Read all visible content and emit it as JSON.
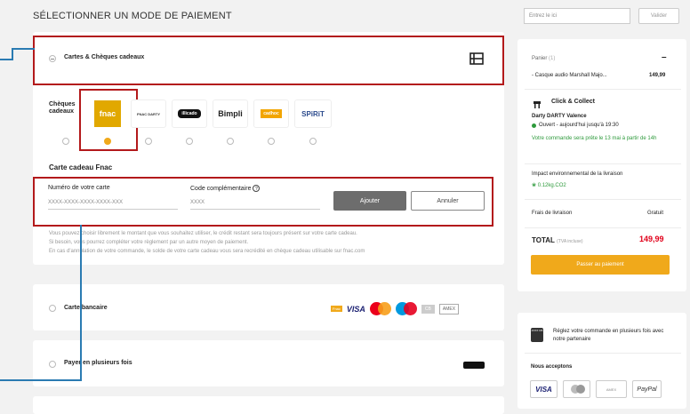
{
  "header": {
    "title": "SÉLECTIONNER UN MODE DE PAIEMENT"
  },
  "gift_section": {
    "label": "Cartes & Chèques cadeaux",
    "cards": [
      {
        "label": "Chèques cadeaux"
      },
      {
        "label": "fnac"
      },
      {
        "label": "FNAC DARTY"
      },
      {
        "label": "illicado"
      },
      {
        "label": "Bimpli"
      },
      {
        "label": "cadhoc"
      },
      {
        "label": "SPiRiT"
      }
    ],
    "form_title": "Carte cadeau Fnac",
    "card_number_label": "Numéro de votre carte",
    "card_number_placeholder": "XXXX-XXXX-XXXX-XXXX-XXX",
    "code_label": "Code complémentaire",
    "code_placeholder": "XXXX",
    "add_button": "Ajouter",
    "cancel_button": "Annuler",
    "info_lines": [
      "Vous pouvez choisir librement le montant que vous souhaitez utiliser, le crédit restant sera toujours présent sur votre carte cadeau.",
      "Si besoin, vous pourrez compléter votre règlement par un autre moyen de paiement.",
      "En cas d'annulation de votre commande, le solde de votre carte cadeau vous sera recrédité en chèque cadeau utilisable sur fnac.com"
    ]
  },
  "card_section": {
    "label": "Carte bancaire",
    "logos": [
      "Fnac",
      "VISA",
      "mastercard",
      "maestro",
      "CB",
      "AMEX"
    ]
  },
  "installment_section": {
    "label": "Payer en plusieurs fois"
  },
  "promo": {
    "placeholder": "Entrez le ici",
    "button": "Valider"
  },
  "cart": {
    "label": "Panier",
    "count": "(1)",
    "collapse": "–",
    "item_name": "- Casque audio Marshall Majo...",
    "item_price": "149,99",
    "collect_title": "Click & Collect",
    "store_name": "Darty DARTY Valence",
    "store_status": "Ouvert - aujourd'hui jusqu'à 19:30",
    "ready_text": "Votre commande sera prête le 13 mai à partir de 14h",
    "impact_label": "Impact environnemental de la livraison",
    "impact_value": "0.12kg.CO2",
    "delivery_label": "Frais de livraison",
    "delivery_value": "Gratuit",
    "total_label": "TOTAL",
    "total_note": "(TVA incluse)",
    "total_value": "149,99",
    "pay_button": "Passer au paiement"
  },
  "installments_promo": {
    "icon_text": "4XXX CB",
    "text": "Réglez votre commande en plusieurs fois avec notre partenaire"
  },
  "accepted": {
    "title": "Nous acceptons",
    "logos": [
      "VISA",
      "mastercard",
      "AMEX",
      "PayPal"
    ]
  },
  "colors": {
    "accent": "#f0a91b",
    "highlight": "#b3191b",
    "price": "#e1001a",
    "annotation": "#2a7bb2"
  }
}
